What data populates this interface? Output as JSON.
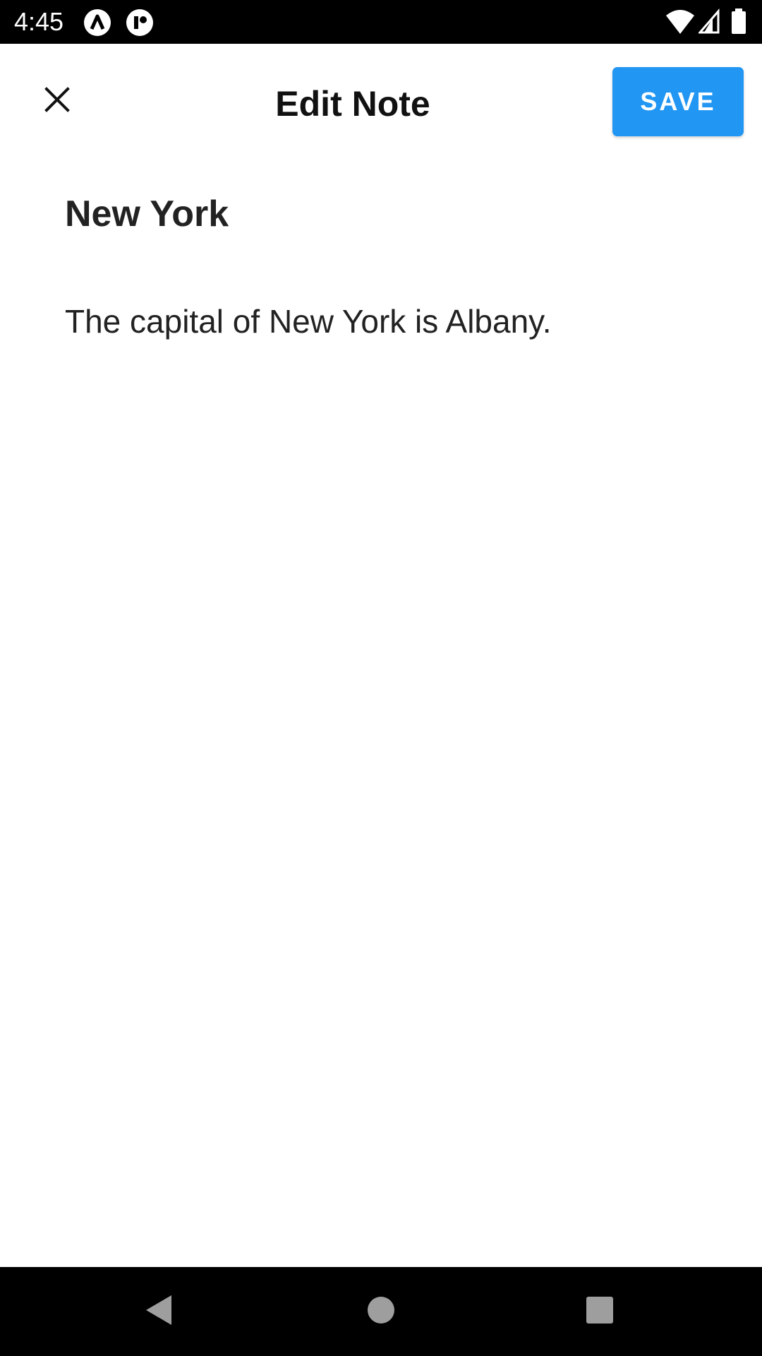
{
  "status_bar": {
    "time": "4:45",
    "icons": [
      "notification-a-icon",
      "notification-r-icon",
      "wifi-icon",
      "signal-icon",
      "battery-icon"
    ]
  },
  "app_bar": {
    "title": "Edit Note",
    "save_label": "SAVE",
    "close_icon": "close-icon"
  },
  "note": {
    "title": "New York",
    "body": "The capital of New York is Albany."
  },
  "nav_bar": {
    "icons": [
      "back-icon",
      "home-icon",
      "recents-icon"
    ]
  },
  "colors": {
    "accent": "#2196f3",
    "status_bar": "#000000",
    "text": "#222222"
  }
}
